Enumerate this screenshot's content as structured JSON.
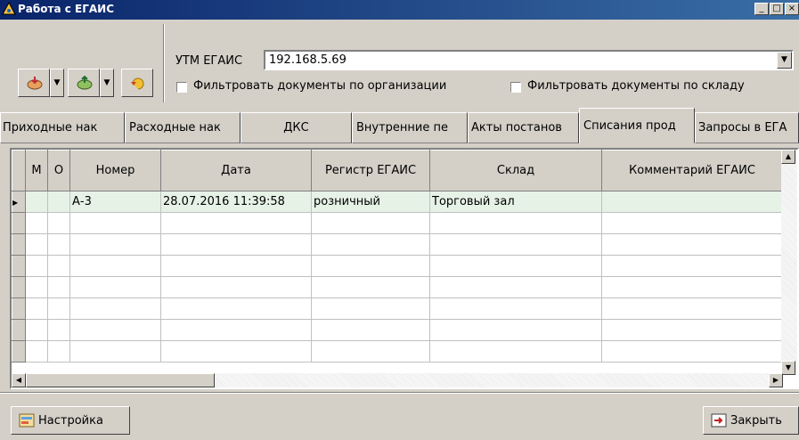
{
  "window": {
    "title": "Работа с ЕГАИС"
  },
  "toolbar": {
    "utm_label": "УТМ ЕГАИС",
    "utm_value": "192.168.5.69",
    "filter_org_label": "Фильтровать документы по организации",
    "filter_org_checked": false,
    "filter_warehouse_label": "Фильтровать документы по складу",
    "filter_warehouse_checked": false
  },
  "tabs": [
    {
      "label": "Приходные нак"
    },
    {
      "label": "Расходные нак"
    },
    {
      "label": "ДКС"
    },
    {
      "label": "Внутренние пе"
    },
    {
      "label": "Акты постанов"
    },
    {
      "label": "Списания прод",
      "active": true
    },
    {
      "label": "Запросы в ЕГА"
    }
  ],
  "grid": {
    "columns": [
      "М",
      "О",
      "Номер",
      "Дата",
      "Регистр ЕГАИС",
      "Склад",
      "Комментарий ЕГАИС"
    ],
    "rows": [
      {
        "m": "",
        "o": "",
        "number": "А-3",
        "date": "28.07.2016 11:39:58",
        "register": "розничный",
        "warehouse": "Торговый зал",
        "comment": ""
      }
    ]
  },
  "footer": {
    "settings_label": "Настройка",
    "close_label": "Закрыть"
  },
  "colors": {
    "title_bar": "#0a246a",
    "selected_row": "#e6f2e6",
    "face": "#d4d0c8"
  }
}
